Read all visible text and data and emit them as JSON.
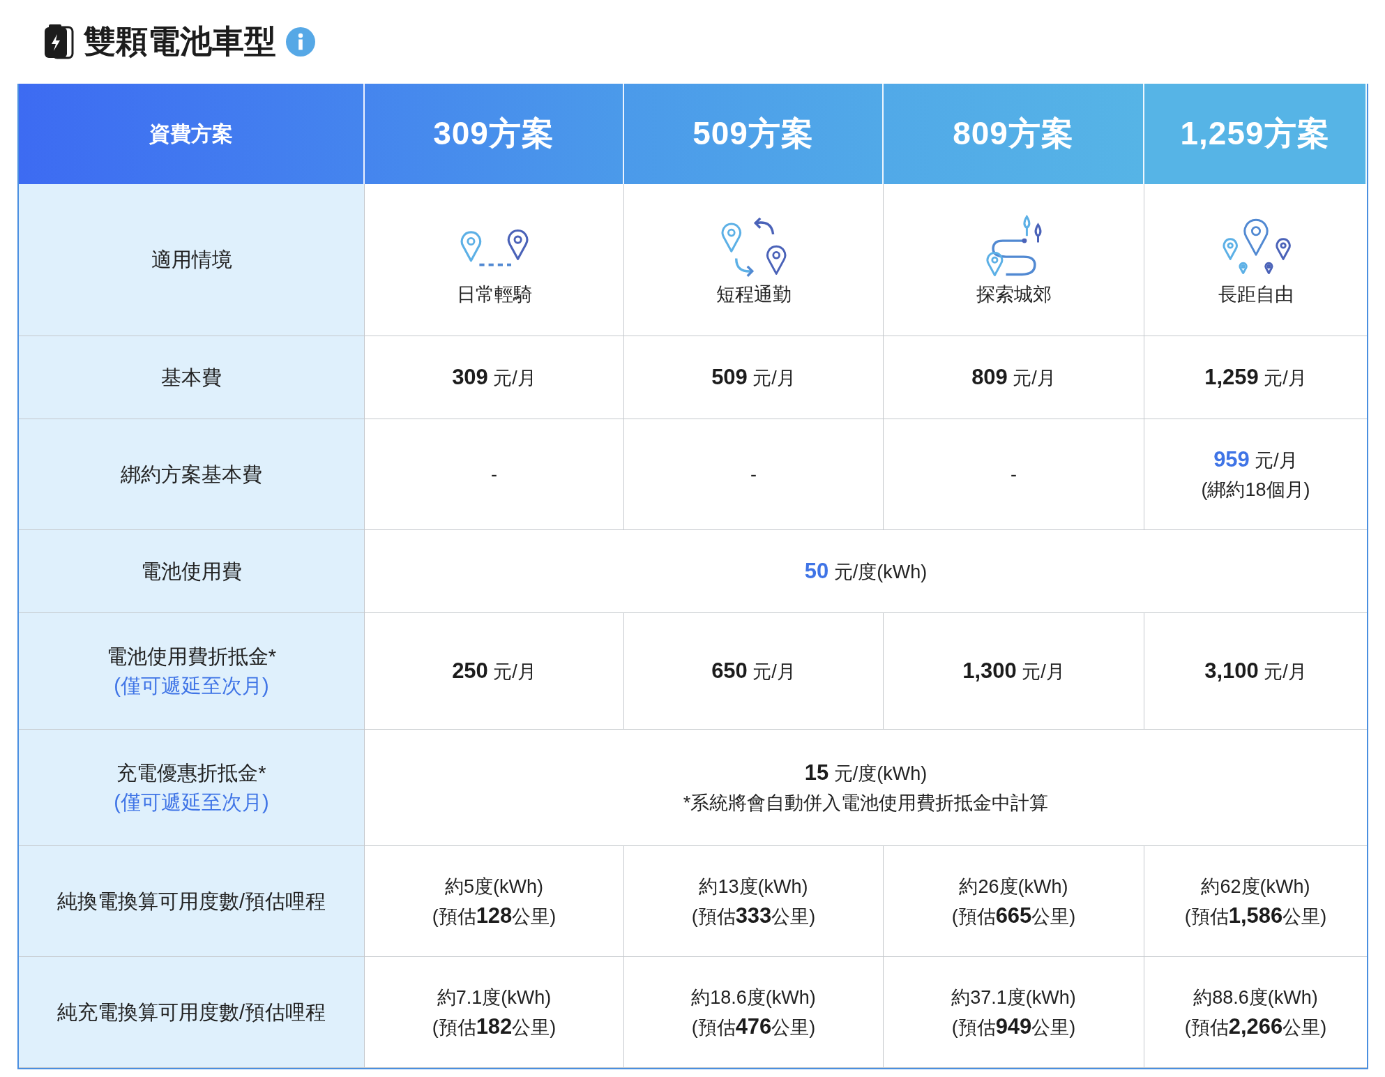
{
  "title": "雙顆電池車型",
  "header": {
    "label": "資費方案",
    "plans": [
      "309方案",
      "509方案",
      "809方案",
      "1,259方案"
    ]
  },
  "rows": [
    {
      "kind": "scenario",
      "label": "適用情境",
      "cells": [
        {
          "caption": "日常輕騎"
        },
        {
          "caption": "短程通勤"
        },
        {
          "caption": "探索城郊"
        },
        {
          "caption": "長距自由"
        }
      ]
    },
    {
      "kind": "per_plan",
      "label": "基本費",
      "cells": [
        {
          "lines": [
            "**309** 元/月"
          ]
        },
        {
          "lines": [
            "**509** 元/月"
          ]
        },
        {
          "lines": [
            "**809** 元/月"
          ]
        },
        {
          "lines": [
            "**1,259** 元/月"
          ]
        }
      ]
    },
    {
      "kind": "per_plan",
      "label": "綁約方案基本費",
      "cells": [
        {
          "lines": [
            "-"
          ]
        },
        {
          "lines": [
            "-"
          ]
        },
        {
          "lines": [
            "-"
          ]
        },
        {
          "lines": [
            "**959** 元/月",
            "(綁約18個月)"
          ],
          "accent": true
        }
      ]
    },
    {
      "kind": "span",
      "label": "電池使用費",
      "cell": {
        "lines": [
          "**50** 元/度(kWh)"
        ],
        "accent": true
      }
    },
    {
      "kind": "per_plan",
      "label": "電池使用費折抵金*",
      "note": "(僅可遞延至次月)",
      "cells": [
        {
          "lines": [
            "**250** 元/月"
          ]
        },
        {
          "lines": [
            "**650** 元/月"
          ]
        },
        {
          "lines": [
            "**1,300** 元/月"
          ]
        },
        {
          "lines": [
            "**3,100** 元/月"
          ]
        }
      ]
    },
    {
      "kind": "span",
      "label": "充電優惠折抵金*",
      "note": "(僅可遞延至次月)",
      "cell": {
        "lines": [
          "**15** 元/度(kWh)",
          "*系統將會自動併入電池使用費折抵金中計算"
        ]
      }
    },
    {
      "kind": "per_plan",
      "label": "純換電換算可用度數/預估哩程",
      "cells": [
        {
          "lines": [
            "約5度(kWh)",
            "(預估**128**公里)"
          ]
        },
        {
          "lines": [
            "約13度(kWh)",
            "(預估**333**公里)"
          ]
        },
        {
          "lines": [
            "約26度(kWh)",
            "(預估**665**公里)"
          ]
        },
        {
          "lines": [
            "約62度(kWh)",
            "(預估**1,586**公里)"
          ]
        }
      ]
    },
    {
      "kind": "per_plan",
      "label": "純充電換算可用度數/預估哩程",
      "cells": [
        {
          "lines": [
            "約7.1度(kWh)",
            "(預估**182**公里)"
          ]
        },
        {
          "lines": [
            "約18.6度(kWh)",
            "(預估**476**公里)"
          ]
        },
        {
          "lines": [
            "約37.1度(kWh)",
            "(預估**949**公里)"
          ]
        },
        {
          "lines": [
            "約88.6度(kWh)",
            "(預估**2,266**公里)"
          ]
        }
      ]
    }
  ]
}
